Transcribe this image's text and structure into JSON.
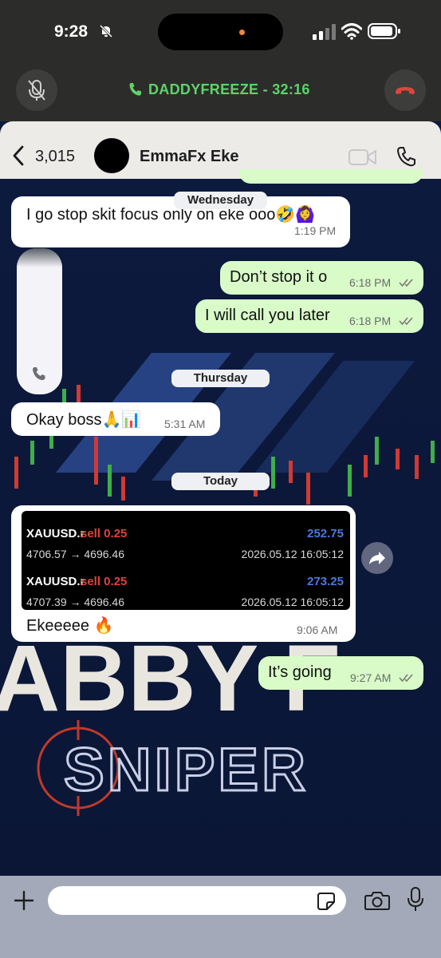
{
  "status_bar": {
    "time": "9:28"
  },
  "call_bar": {
    "label": "DADDYFREEZE - 32:16"
  },
  "chat_header": {
    "back_count": "3,015",
    "contact_name": "EmmaFx Eke"
  },
  "dates": {
    "wednesday": "Wednesday",
    "thursday": "Thursday",
    "today": "Today"
  },
  "messages": [
    {
      "text": "I go stop skit focus only on eke ooo🤣🙆‍♀️",
      "time": "1:19 PM"
    },
    {
      "text": "Don’t stop it o",
      "time": "6:18 PM"
    },
    {
      "text": "I will call you later",
      "time": "6:18 PM"
    },
    {
      "text": "Okay boss🙏📊",
      "time": "5:31 AM"
    },
    {
      "text": "Ekeeeee 🔥",
      "time": "9:06 AM"
    },
    {
      "text": "It’s going",
      "time": "9:27 AM"
    }
  ],
  "trades": [
    {
      "symbol": "XAUUSD.r",
      "side": "sell 0.25",
      "profit": "252.75",
      "prices": "4706.57 → 4696.46",
      "timestamp": "2026.05.12 16:05:12"
    },
    {
      "symbol": "XAUUSD.r",
      "side": "sell 0.25",
      "profit": "273.25",
      "prices": "4707.39 → 4696.46",
      "timestamp": "2026.05.12 16:05:12"
    }
  ],
  "wallpaper_text": {
    "line1": "ABBY F",
    "line2": "SNIPER"
  },
  "colors": {
    "call_green": "#5fd36a",
    "end_call_red": "#e0453c",
    "outgoing_bubble": "#d8fbc8",
    "sell_red": "#e0433a",
    "profit_blue": "#4a78e0"
  },
  "icons": [
    "bell-slash-icon",
    "signal-icon",
    "wifi-icon",
    "battery-icon",
    "mic-off-icon",
    "phone-icon",
    "end-call-icon",
    "back-chevron-icon",
    "video-icon",
    "forward-icon",
    "plus-icon",
    "sticker-icon",
    "camera-icon",
    "mic-icon"
  ]
}
